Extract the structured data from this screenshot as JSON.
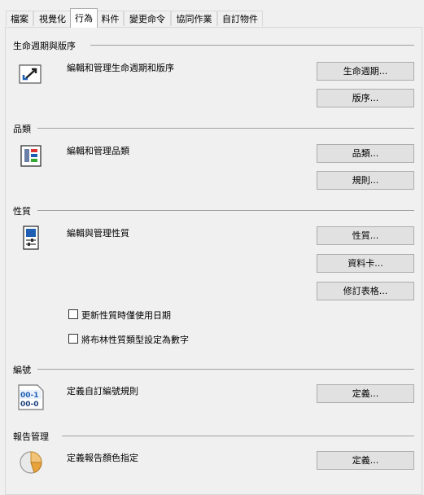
{
  "tabs": [
    "檔案",
    "視覺化",
    "行為",
    "料件",
    "變更命令",
    "協同作業",
    "自訂物件"
  ],
  "active_tab": 2,
  "sections": {
    "lifecycle": {
      "title": "生命週期與版序",
      "desc": "編輯和管理生命週期和版序",
      "buttons": [
        "生命週期...",
        "版序..."
      ]
    },
    "category": {
      "title": "品類",
      "desc": "編輯和管理品類",
      "buttons": [
        "品類...",
        "規則..."
      ]
    },
    "properties": {
      "title": "性質",
      "desc": "編輯與管理性質",
      "buttons": [
        "性質...",
        "資料卡...",
        "修訂表格..."
      ],
      "checkboxes": [
        {
          "label": "更新性質時僅使用日期",
          "checked": false
        },
        {
          "label": "將布林性質類型設定為數字",
          "checked": false
        }
      ]
    },
    "numbering": {
      "title": "編號",
      "desc": "定義自訂編號規則",
      "buttons": [
        "定義..."
      ],
      "icon_text": [
        "00-1",
        "00-0"
      ]
    },
    "report": {
      "title": "報告管理",
      "desc": "定義報告顏色指定",
      "buttons": [
        "定義..."
      ]
    }
  },
  "icons": {
    "lifecycle": "lifecycle-arrows-icon",
    "category": "category-grid-icon",
    "properties": "properties-card-icon",
    "numbering": "numbering-icon",
    "report": "pie-chart-icon"
  },
  "colors": {
    "accent": "#1e5fb4",
    "red": "#d33",
    "green": "#3a3",
    "orange": "#e8a33d"
  }
}
